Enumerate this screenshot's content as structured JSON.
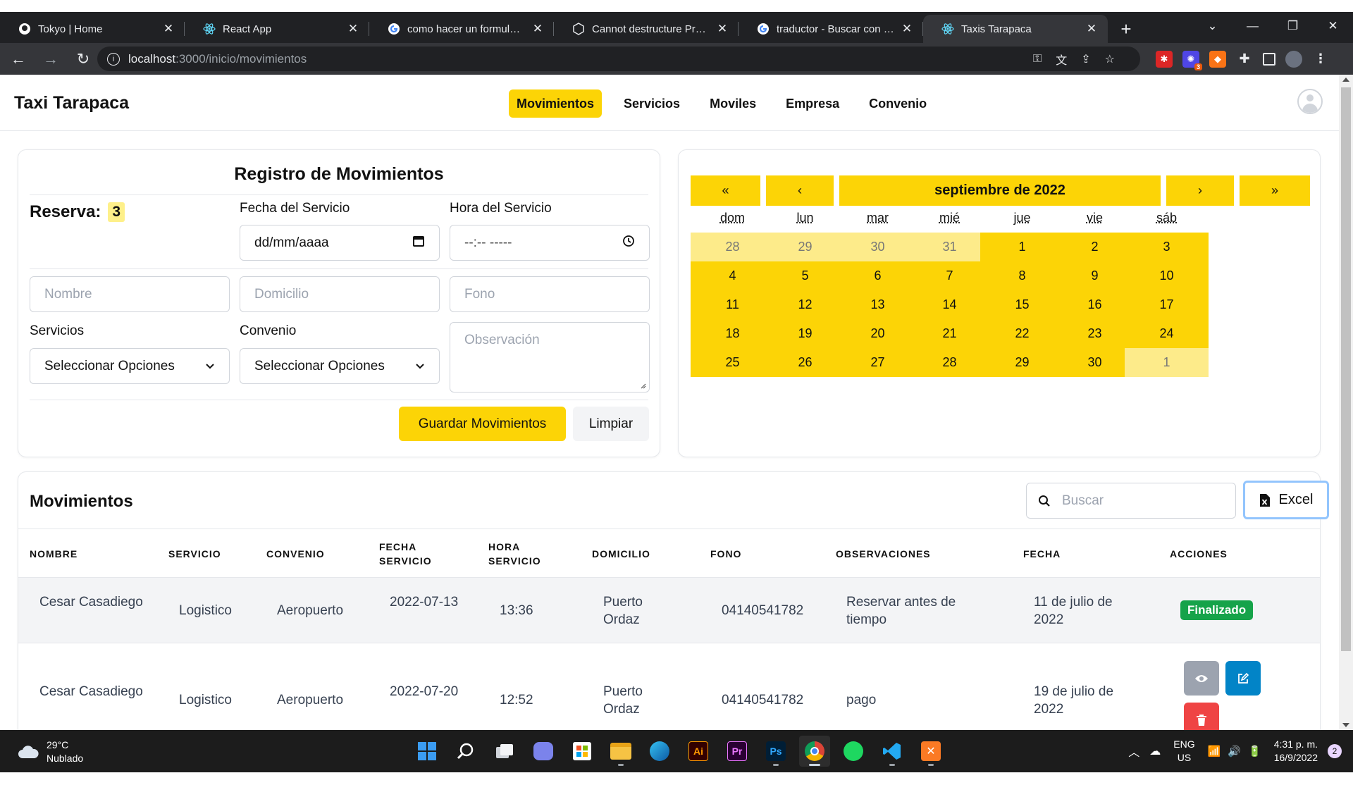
{
  "browser": {
    "tabs": [
      {
        "title": "Tokyo | Home",
        "icon": "github-icon",
        "active": false
      },
      {
        "title": "React App",
        "icon": "react-icon",
        "active": false
      },
      {
        "title": "como hacer un formulario c",
        "icon": "google-icon",
        "active": false
      },
      {
        "title": "Cannot destructure Propert",
        "icon": "codesandbox-icon",
        "active": false
      },
      {
        "title": "traductor - Buscar con Goo",
        "icon": "google-icon",
        "active": false
      },
      {
        "title": "Taxis Tarapaca",
        "icon": "react-icon",
        "active": true
      }
    ],
    "url_host": "localhost",
    "url_path": ":3000/inicio/movimientos",
    "extension_badge": "3"
  },
  "navbar": {
    "brand": "Taxi Tarapaca",
    "links": [
      "Movimientos",
      "Servicios",
      "Moviles",
      "Empresa",
      "Convenio"
    ],
    "active_link": "Movimientos"
  },
  "form": {
    "title": "Registro de Movimientos",
    "reserva_label": "Reserva:",
    "reserva_value": "3",
    "fecha_label": "Fecha del Servicio",
    "fecha_placeholder": "dd/mm/aaaa",
    "hora_label": "Hora del Servicio",
    "hora_placeholder": "--:-- -----",
    "nombre_placeholder": "Nombre",
    "domicilio_placeholder": "Domicilio",
    "fono_placeholder": "Fono",
    "servicios_label": "Servicios",
    "servicios_value": "Seleccionar Opciones",
    "convenio_label": "Convenio",
    "convenio_value": "Seleccionar Opciones",
    "observacion_placeholder": "Observación",
    "save_label": "Guardar Movimientos",
    "clear_label": "Limpiar"
  },
  "calendar": {
    "prev_year": "«",
    "prev_month": "‹",
    "title": "septiembre de 2022",
    "next_month": "›",
    "next_year": "»",
    "weekdays": [
      "dom",
      "lun",
      "mar",
      "mié",
      "jue",
      "vie",
      "sáb"
    ],
    "weeks": [
      [
        {
          "d": "28",
          "m": true
        },
        {
          "d": "29",
          "m": true
        },
        {
          "d": "30",
          "m": true
        },
        {
          "d": "31",
          "m": true
        },
        {
          "d": "1",
          "m": false
        },
        {
          "d": "2",
          "m": false
        },
        {
          "d": "3",
          "m": false
        }
      ],
      [
        {
          "d": "4",
          "m": false
        },
        {
          "d": "5",
          "m": false
        },
        {
          "d": "6",
          "m": false
        },
        {
          "d": "7",
          "m": false
        },
        {
          "d": "8",
          "m": false
        },
        {
          "d": "9",
          "m": false
        },
        {
          "d": "10",
          "m": false
        }
      ],
      [
        {
          "d": "11",
          "m": false
        },
        {
          "d": "12",
          "m": false
        },
        {
          "d": "13",
          "m": false
        },
        {
          "d": "14",
          "m": false
        },
        {
          "d": "15",
          "m": false
        },
        {
          "d": "16",
          "m": false
        },
        {
          "d": "17",
          "m": false
        }
      ],
      [
        {
          "d": "18",
          "m": false
        },
        {
          "d": "19",
          "m": false
        },
        {
          "d": "20",
          "m": false
        },
        {
          "d": "21",
          "m": false
        },
        {
          "d": "22",
          "m": false
        },
        {
          "d": "23",
          "m": false
        },
        {
          "d": "24",
          "m": false
        }
      ],
      [
        {
          "d": "25",
          "m": false
        },
        {
          "d": "26",
          "m": false
        },
        {
          "d": "27",
          "m": false
        },
        {
          "d": "28",
          "m": false
        },
        {
          "d": "29",
          "m": false
        },
        {
          "d": "30",
          "m": false
        },
        {
          "d": "1",
          "m": true
        }
      ]
    ]
  },
  "table": {
    "title": "Movimientos",
    "search_placeholder": "Buscar",
    "excel_label": "Excel",
    "columns": [
      "NOMBRE",
      "SERVICIO",
      "CONVENIO",
      "FECHA SERVICIO",
      "HORA SERVICIO",
      "DOMICILIO",
      "FONO",
      "OBSERVACIONES",
      "FECHA",
      "ACCIONES"
    ],
    "rows": [
      {
        "nombre": "Cesar Casadiego",
        "servicio": "Logistico",
        "convenio": "Aeropuerto",
        "fecha_servicio": "2022-07-13",
        "hora": "13:36",
        "domicilio": "Puerto Ordaz",
        "fono": "04140541782",
        "observaciones": "Reservar antes de tiempo",
        "fecha": "11 de julio de 2022",
        "status": "Finalizado"
      },
      {
        "nombre": "Cesar Casadiego",
        "servicio": "Logistico",
        "convenio": "Aeropuerto",
        "fecha_servicio": "2022-07-20",
        "hora": "12:52",
        "domicilio": "Puerto Ordaz",
        "fono": "04140541782",
        "observaciones": "pago",
        "fecha": "19 de julio de 2022",
        "status": ""
      }
    ]
  },
  "taskbar": {
    "temperature": "29°C",
    "weather": "Nublado",
    "lang1": "ENG",
    "lang2": "US",
    "time": "4:31 p. m.",
    "date": "16/9/2022",
    "notifications": "2"
  },
  "colors": {
    "accent": "#fcd406",
    "accent_muted": "#fdeb8a",
    "success": "#16a34a",
    "info": "#0284c7",
    "danger": "#ef4444"
  }
}
